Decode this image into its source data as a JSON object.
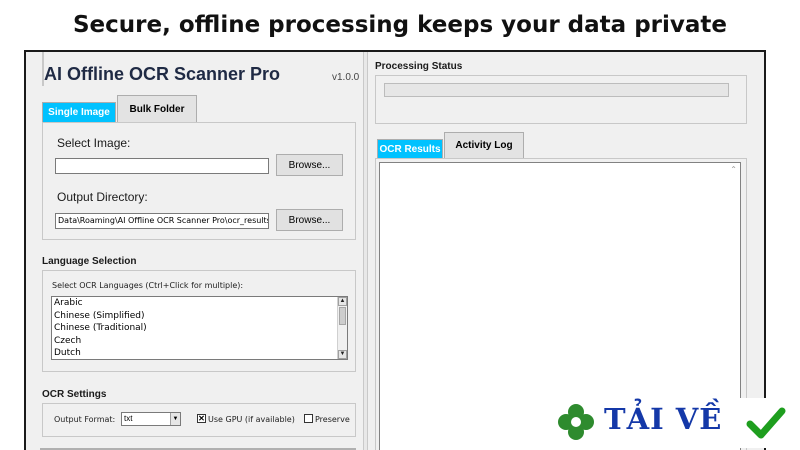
{
  "headline": "Secure, offline processing keeps your data private",
  "app": {
    "title": "AI Offline OCR Scanner Pro",
    "version": "v1.0.0"
  },
  "input_tabs": [
    {
      "label": "Single Image",
      "active": true
    },
    {
      "label": "Bulk Folder",
      "active": false
    }
  ],
  "single_image": {
    "select_label": "Select Image:",
    "select_value": "",
    "browse_label": "Browse...",
    "output_label": "Output Directory:",
    "output_value": "Data\\Roaming\\AI Offline OCR Scanner Pro\\ocr_results",
    "output_browse_label": "Browse..."
  },
  "language": {
    "section_title": "Language Selection",
    "instructions": "Select OCR Languages (Ctrl+Click for multiple):",
    "options": [
      "Arabic",
      "Chinese (Simplified)",
      "Chinese (Traditional)",
      "Czech",
      "Dutch"
    ]
  },
  "ocr_settings": {
    "section_title": "OCR Settings",
    "format_label": "Output Format:",
    "format_value": "txt",
    "use_gpu_label": "Use GPU (if available)",
    "use_gpu_checked": true,
    "preserve_label": "Preserve",
    "preserve_checked": false
  },
  "status": {
    "section_title": "Processing Status",
    "progress": 0
  },
  "output_tabs": [
    {
      "label": "OCR Results",
      "active": true
    },
    {
      "label": "Activity Log",
      "active": false
    }
  ],
  "results_text": "",
  "badge": {
    "text": "TẢI VỀ",
    "clover_color": "#2e8b2e",
    "check_color": "#1e9e1e"
  },
  "colors": {
    "accent_tab": "#00c2ff",
    "title": "#1f2a44",
    "badge_text": "#1438a8"
  }
}
